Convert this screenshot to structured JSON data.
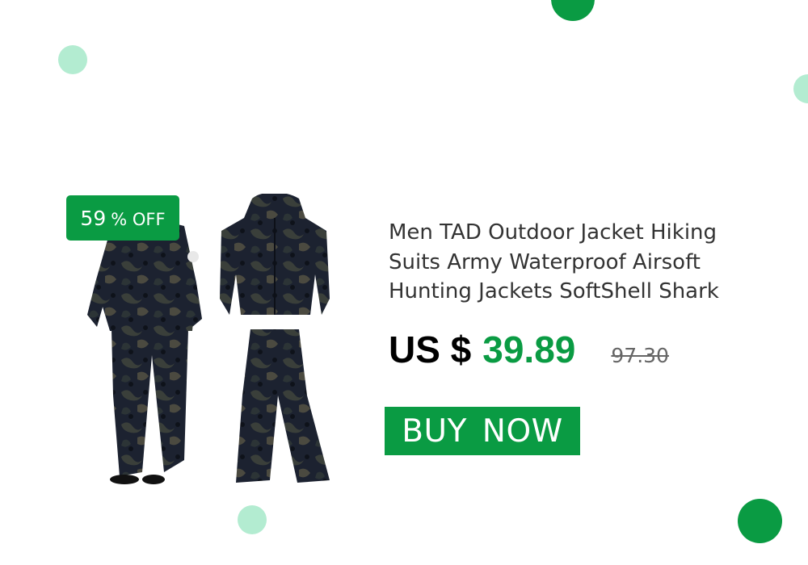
{
  "product": {
    "title": "Men TAD Outdoor Jacket Hiking Suits Army Waterproof Airsoft Hunting Jackets SoftShell  Shark",
    "image_alt": "Camouflage softshell jacket and pants suit",
    "discount": {
      "value": "59",
      "label": "% OFF"
    },
    "price": {
      "currency": "US $",
      "sale": "39.89",
      "original": "97.30"
    }
  },
  "cta": {
    "label": "BUY  NOW"
  },
  "colors": {
    "brand_green": "#0a9b43",
    "light_green": "#b3ecd1",
    "title_text": "#333333",
    "strike_text": "#666666"
  }
}
